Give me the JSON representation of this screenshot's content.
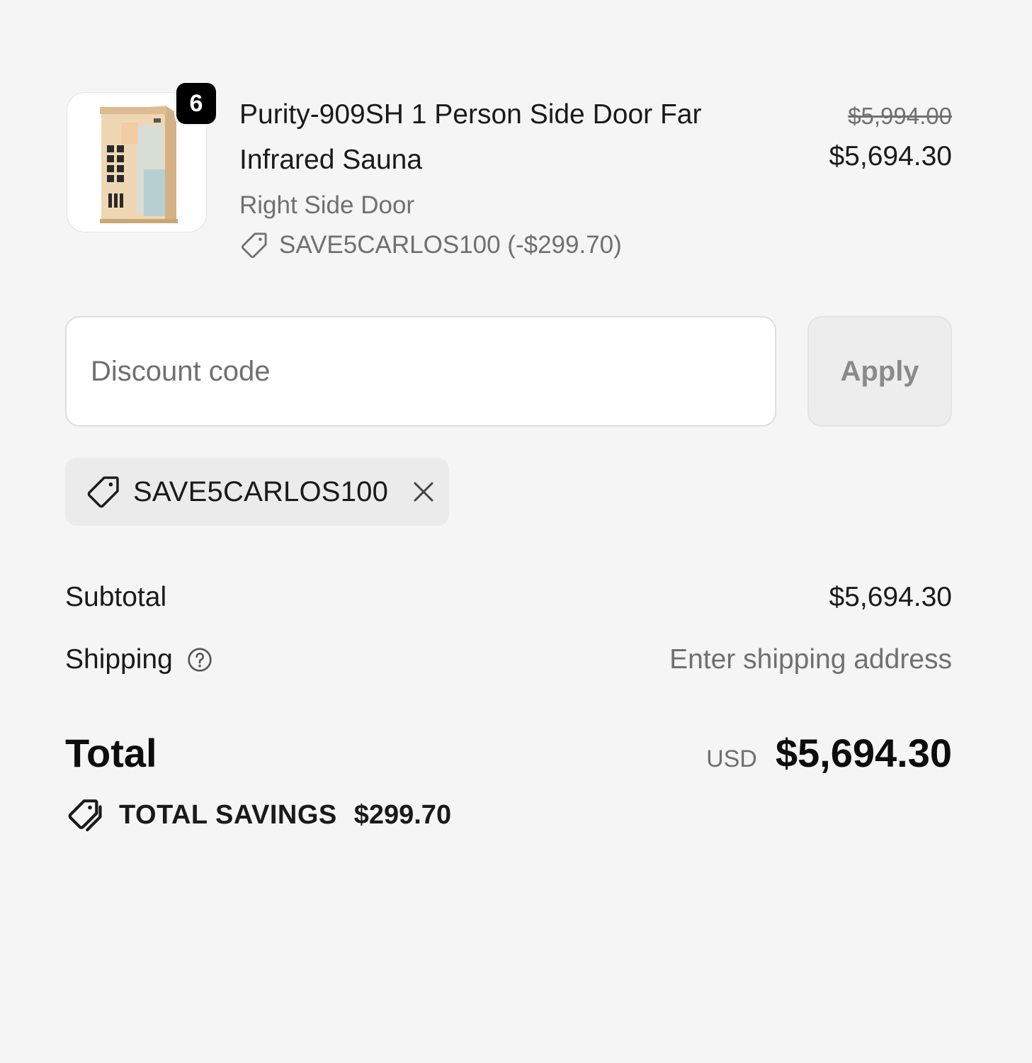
{
  "line_item": {
    "quantity": "6",
    "title": "Purity-909SH 1 Person Side Door Far Infrared Sauna",
    "variant": "Right Side Door",
    "discount_line": "SAVE5CARLOS100 (-$299.70)",
    "compare_at_price": "$5,994.00",
    "price": "$5,694.30",
    "image_icon": "sauna-product-image"
  },
  "discount_form": {
    "placeholder": "Discount code",
    "value": "",
    "apply_label": "Apply"
  },
  "applied_code": {
    "label": "SAVE5CARLOS100",
    "remove_icon": "close-icon"
  },
  "totals": {
    "subtotal_label": "Subtotal",
    "subtotal_value": "$5,694.30",
    "shipping_label": "Shipping",
    "shipping_value": "Enter shipping address",
    "total_label": "Total",
    "currency": "USD",
    "total_value": "$5,694.30",
    "savings_label": "TOTAL SAVINGS",
    "savings_value": "$299.70"
  },
  "colors": {
    "background": "#f5f5f5",
    "text": "#1a1a1a",
    "muted": "#707070",
    "badge": "#000000",
    "chip": "#ebebeb"
  }
}
